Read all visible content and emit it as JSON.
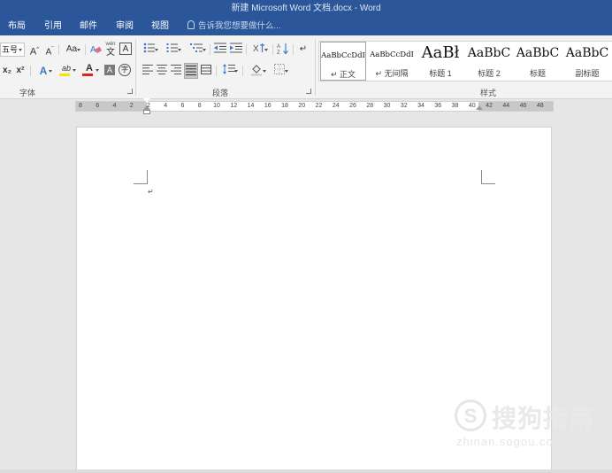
{
  "window": {
    "title": "新建 Microsoft Word 文档.docx - Word"
  },
  "menu": {
    "tabs": [
      "布局",
      "引用",
      "邮件",
      "审阅",
      "视图"
    ],
    "tell_me": "告诉我您想要做什么..."
  },
  "ribbon": {
    "font_group": {
      "label": "字体",
      "font_size": "五号",
      "grow_font": "A",
      "shrink_font": "A",
      "change_case": "Aa",
      "phonetic": "wén",
      "phonetic_sub": "文",
      "char_border": "A",
      "subscript": "x₂",
      "superscript": "x²",
      "text_effect": "A",
      "highlight": "ab",
      "font_color": "A",
      "char_shading": "A",
      "enclose_char": "字",
      "colors": {
        "highlight": "#f5e300",
        "font_color": "#e0221b",
        "text_effect": "#3a78c8"
      }
    },
    "paragraph_group": {
      "label": "段落"
    },
    "styles_group": {
      "label": "样式",
      "styles": [
        {
          "sample": "AaBbCcDdI",
          "name": "正文",
          "marker": "↵",
          "selected": true,
          "size": "s"
        },
        {
          "sample": "AaBbCcDdI",
          "name": "无间隔",
          "marker": "↵",
          "selected": false,
          "size": "s"
        },
        {
          "sample": "AaBł",
          "name": "标题 1",
          "marker": "",
          "selected": false,
          "size": "l"
        },
        {
          "sample": "AaBbC",
          "name": "标题 2",
          "marker": "",
          "selected": false,
          "size": "m"
        },
        {
          "sample": "AaBbC",
          "name": "标题",
          "marker": "",
          "selected": false,
          "size": "m"
        },
        {
          "sample": "AaBbC",
          "name": "副标题",
          "marker": "",
          "selected": false,
          "size": "m"
        }
      ]
    }
  },
  "ruler": {
    "ticks": [
      "8",
      "6",
      "4",
      "2",
      "2",
      "4",
      "6",
      "8",
      "10",
      "12",
      "14",
      "16",
      "18",
      "20",
      "22",
      "24",
      "26",
      "28",
      "30",
      "32",
      "34",
      "36",
      "38",
      "40",
      "42",
      "44",
      "46",
      "48"
    ]
  },
  "document": {
    "paragraph_mark": "↵"
  },
  "watermark": {
    "logo": "S",
    "text": "搜狗指南",
    "url": "zhinan.sogou.com"
  }
}
